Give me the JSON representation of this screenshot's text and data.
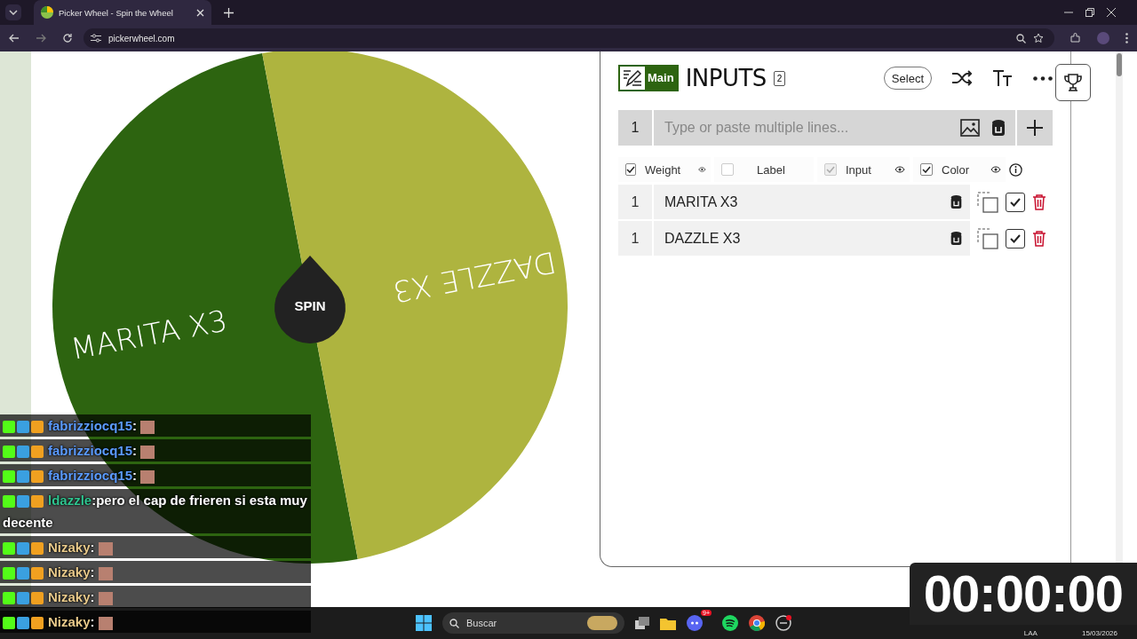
{
  "browser": {
    "tab_title": "Picker Wheel - Spin the Wheel",
    "url": "pickerwheel.com"
  },
  "wheel": {
    "spin_label": "SPIN",
    "slices": [
      {
        "label": "MARITA X3",
        "color": "#2d6410"
      },
      {
        "label": "DAZZLE X3",
        "color": "#aeb43f"
      }
    ]
  },
  "inputs": {
    "tab_label": "Main",
    "title": "INPUTS",
    "count": "2",
    "select_label": "Select",
    "new_entry": {
      "weight": "1",
      "placeholder": "Type or paste multiple lines..."
    },
    "columns": [
      {
        "label": "Weight",
        "checked": true,
        "disabled": false,
        "eye": true
      },
      {
        "label": "Label",
        "checked": false,
        "disabled": false,
        "eye": false
      },
      {
        "label": "Input",
        "checked": true,
        "disabled": true,
        "eye": true
      },
      {
        "label": "Color",
        "checked": true,
        "disabled": false,
        "eye": true
      }
    ],
    "entries": [
      {
        "weight": "1",
        "text": "MARITA X3",
        "checked": true
      },
      {
        "weight": "1",
        "text": "DAZZLE X3",
        "checked": true
      }
    ]
  },
  "chat": [
    {
      "kind": "emote",
      "user": "fabrizziocq15",
      "color": "#5b9bff",
      "separator": ":"
    },
    {
      "kind": "emote",
      "user": "fabrizziocq15",
      "color": "#5b9bff",
      "separator": ":"
    },
    {
      "kind": "emote",
      "user": "fabrizziocq15",
      "color": "#5b9bff",
      "separator": ":"
    },
    {
      "kind": "text",
      "user": "ldazzle",
      "color": "#2fc48f",
      "separator": ":",
      "text": "pero el cap de frieren si esta muy decente"
    },
    {
      "kind": "emote",
      "user": "Nizaky",
      "color": "#e8c98a",
      "separator": ":"
    },
    {
      "kind": "emote",
      "user": "Nizaky",
      "color": "#e8c98a",
      "separator": ":"
    },
    {
      "kind": "emote",
      "user": "Nizaky",
      "color": "#e8c98a",
      "separator": ":"
    },
    {
      "kind": "emote",
      "user": "Nizaky",
      "color": "#e8c98a",
      "separator": ":"
    }
  ],
  "timer": "00:00:00",
  "taskbar": {
    "search_placeholder": "Buscar",
    "notification_badge": "9+",
    "language": "LAA",
    "date": "15/03/2026"
  }
}
